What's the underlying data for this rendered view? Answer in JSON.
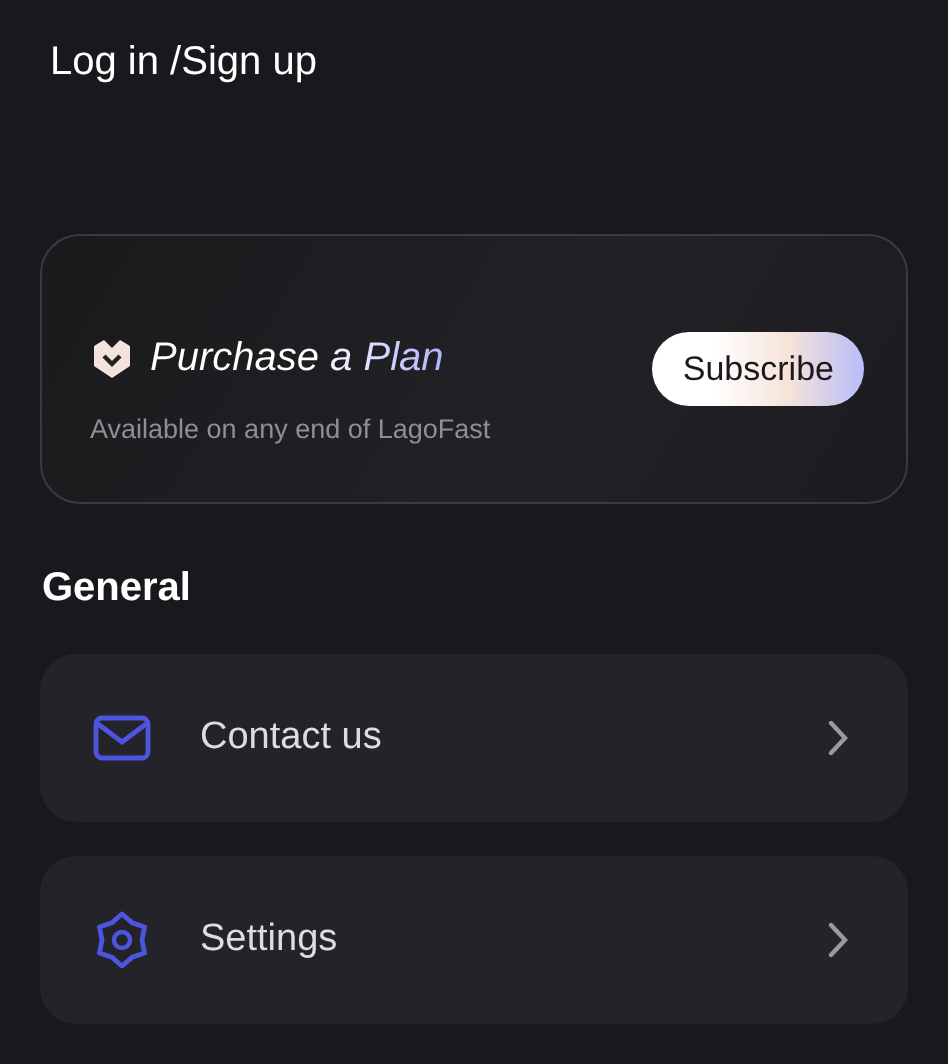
{
  "header": {
    "login_link": "Log in /Sign up"
  },
  "plan_card": {
    "title": "Purchase a Plan",
    "subtitle": "Available on any end of LagoFast",
    "button": "Subscribe"
  },
  "section": {
    "title": "General"
  },
  "menu": [
    {
      "kind": "mail",
      "label": "Contact us"
    },
    {
      "kind": "gear",
      "label": "Settings"
    }
  ]
}
